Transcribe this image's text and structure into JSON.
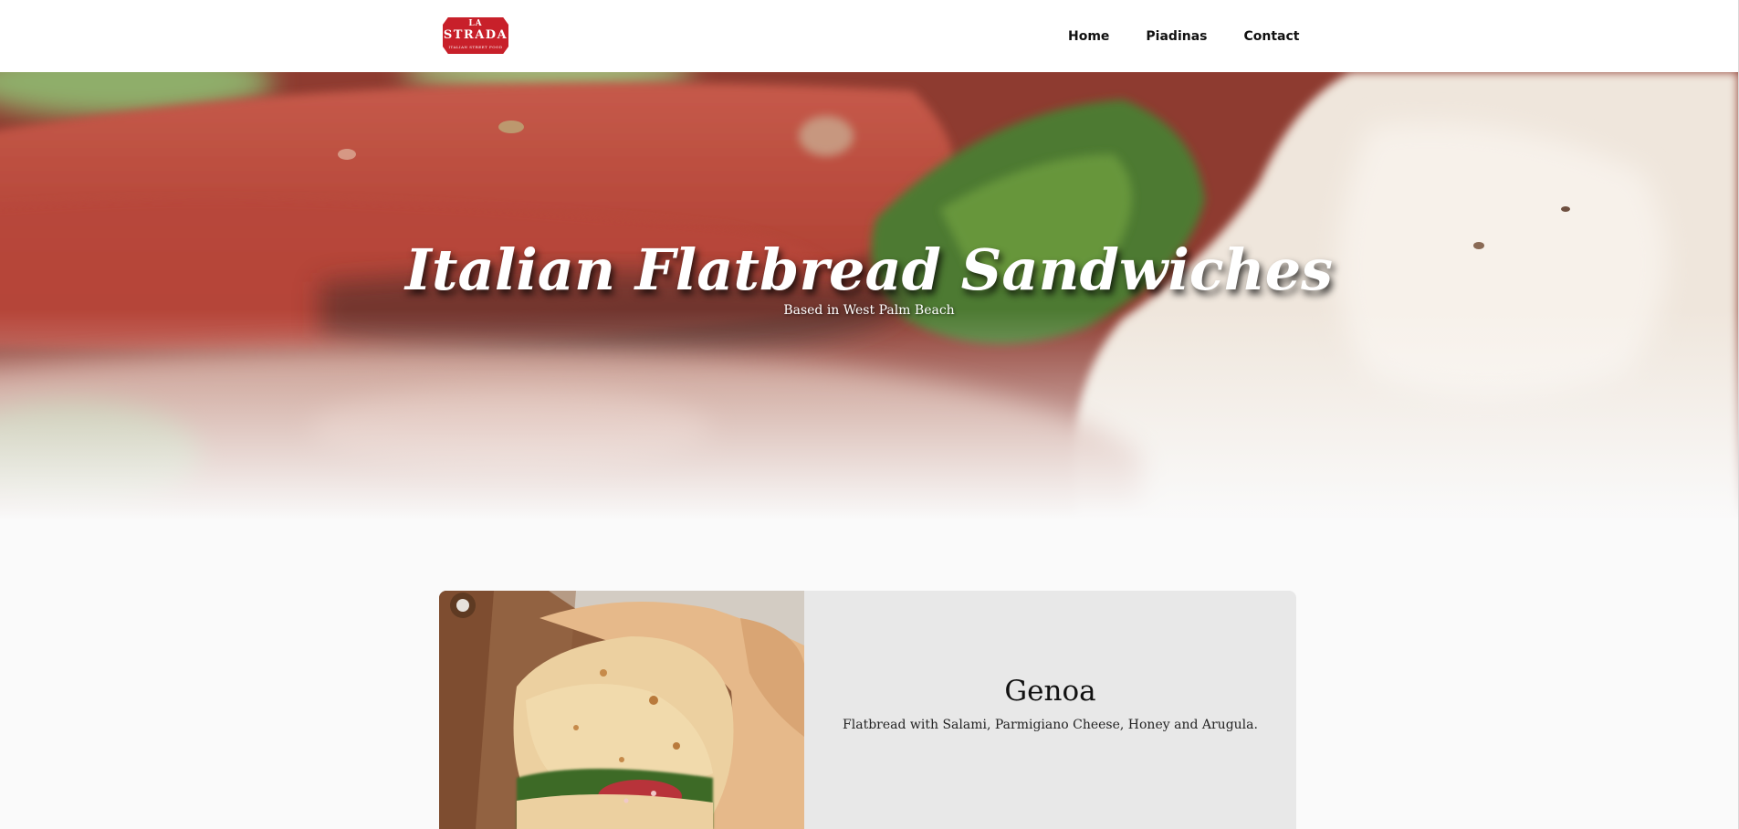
{
  "header": {
    "logo": {
      "line1": "LA",
      "line2": "STRADA",
      "line3": "ITALIAN STREET FOOD",
      "color": "#c8202a"
    },
    "nav": [
      {
        "label": "Home"
      },
      {
        "label": "Piadinas"
      },
      {
        "label": "Contact"
      }
    ]
  },
  "hero": {
    "title": "Italian Flatbread Sandwiches",
    "subtitle": "Based in West Palm Beach"
  },
  "products": [
    {
      "name": "Genoa",
      "description": "Flatbread with Salami, Parmigiano Cheese, Honey and Arugula."
    }
  ]
}
